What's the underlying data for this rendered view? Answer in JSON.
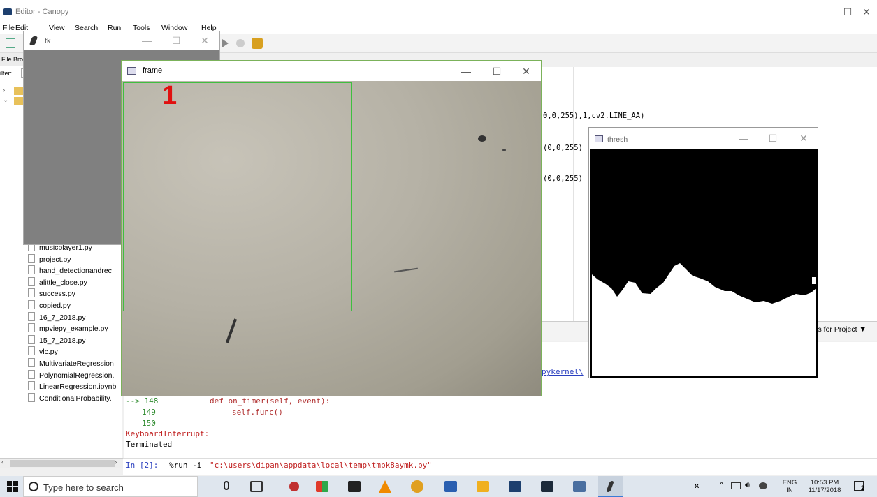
{
  "canopy": {
    "title": "Editor - Canopy",
    "menu": [
      "File",
      "Edit",
      "View",
      "Search",
      "Run",
      "Tools",
      "Window",
      "Help"
    ],
    "file_browser": {
      "header": "File Bro",
      "filter_label": "ilter:",
      "files": [
        "musicplayer1.py",
        "project.py",
        "hand_detectionandrec",
        "alittle_close.py",
        "success.py",
        "copied.py",
        "16_7_2018.py",
        "mpviepy_example.py",
        "15_7_2018.py",
        "vlc.py",
        "MultivariateRegression",
        "PolynomialRegression.",
        "LinearRegression.ipynb",
        "ConditionalProbability."
      ]
    },
    "editor_lines": [
      "0,0,255),1,cv2.LINE_AA)",
      "(0,0,255)",
      "(0,0,255)"
    ],
    "files_for_project": "iles for Project",
    "shell_path_fragment": "pykernel\\",
    "shell": {
      "traceback_arrow": "--> 148",
      "line_148_code": "def on_timer(self, event):",
      "line_149_num": "149",
      "line_149_code": "self.func()",
      "line_150_num": "150",
      "error": "KeyboardInterrupt:",
      "status": "Terminated",
      "prompt": "In [2]:",
      "command": "%run -i ",
      "command_path": "\"c:\\users\\dipan\\appdata\\local\\temp\\tmpk8aymk.py\""
    }
  },
  "tk_window": {
    "title": "tk"
  },
  "frame_window": {
    "title": "frame",
    "count": "1"
  },
  "thresh_window": {
    "title": "thresh"
  },
  "window_controls": {
    "minimize": "—",
    "maximize": "☐",
    "close": "✕"
  },
  "taskbar": {
    "search_placeholder": "Type here to search",
    "language": "ENG",
    "region": "IN",
    "time": "10:53 PM",
    "date": "11/17/2018",
    "notification_count": "2"
  },
  "colors": {
    "roi_box": "#3fbf3f",
    "count_text": "#e01010",
    "shell_error": "#c02020",
    "shell_line_numbers": "#2e8b2e"
  }
}
